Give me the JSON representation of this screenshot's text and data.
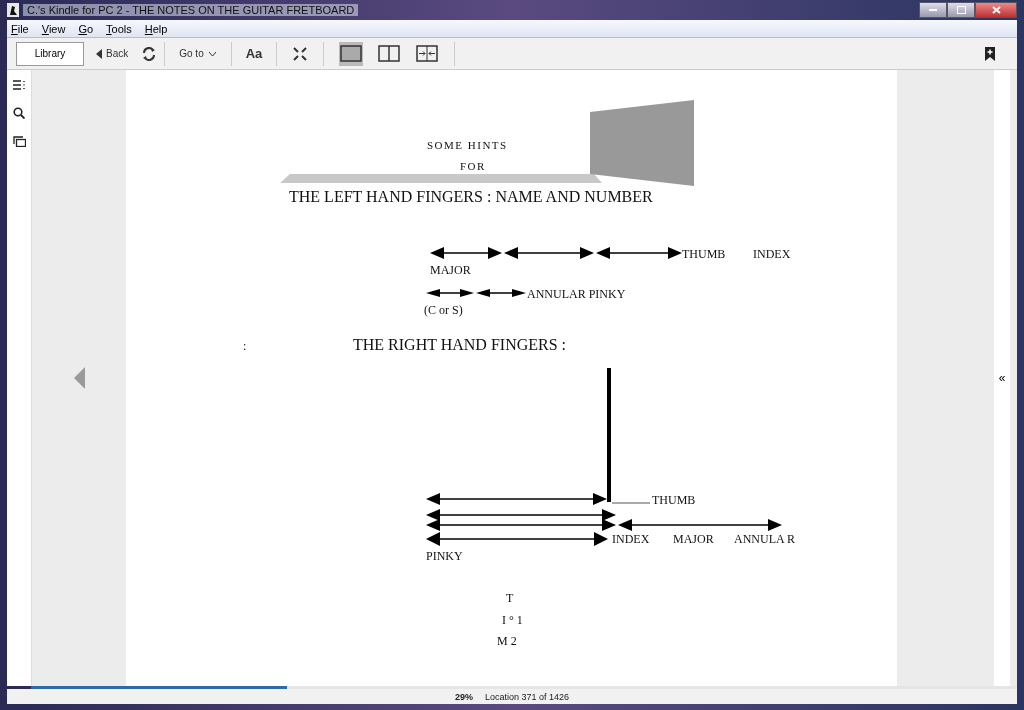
{
  "window": {
    "title": "C.'s Kindle for PC 2 - THE NOTES ON THE GUITAR FRETBOARD"
  },
  "menu": [
    "File",
    "View",
    "Go",
    "Tools",
    "Help"
  ],
  "toolbar": {
    "library": "Library",
    "back": "Back",
    "goto": "Go to",
    "font": "Aa",
    "layouts": [
      {
        "kind": "single",
        "selected": true
      },
      {
        "kind": "double",
        "selected": false
      },
      {
        "kind": "fit",
        "selected": false
      }
    ]
  },
  "page": {
    "labels": [
      {
        "text": "SOME HINTS",
        "kind": "spaced"
      },
      {
        "text": "FOR",
        "kind": "spaced"
      },
      {
        "text": "THE LEFT HAND FINGERS : NAME AND NUMBER",
        "kind": "heading"
      },
      {
        "text": "THUMB",
        "kind": "label"
      },
      {
        "text": "INDEX",
        "kind": "label"
      },
      {
        "text": "MAJOR",
        "kind": "label"
      },
      {
        "text": "ANNULAR PINKY",
        "kind": "label"
      },
      {
        "text": "(C or S)",
        "kind": "label"
      },
      {
        "text": ":",
        "kind": "label"
      },
      {
        "text": "THE RIGHT HAND FINGERS :",
        "kind": "heading"
      },
      {
        "text": "THUMB",
        "kind": "label"
      },
      {
        "text": "INDEX",
        "kind": "label"
      },
      {
        "text": "MAJOR",
        "kind": "label"
      },
      {
        "text": "ANNULA R",
        "kind": "label"
      },
      {
        "text": "PINKY",
        "kind": "label"
      },
      {
        "text": "T",
        "kind": "label"
      },
      {
        "text": "I ° 1",
        "kind": "label"
      },
      {
        "text": "M  2",
        "kind": "label"
      }
    ]
  },
  "side_panel": {
    "toggle": "«"
  },
  "progress": {
    "level": 0.26
  },
  "status": {
    "percent": "29%",
    "location": "Location 371 of 1426"
  }
}
